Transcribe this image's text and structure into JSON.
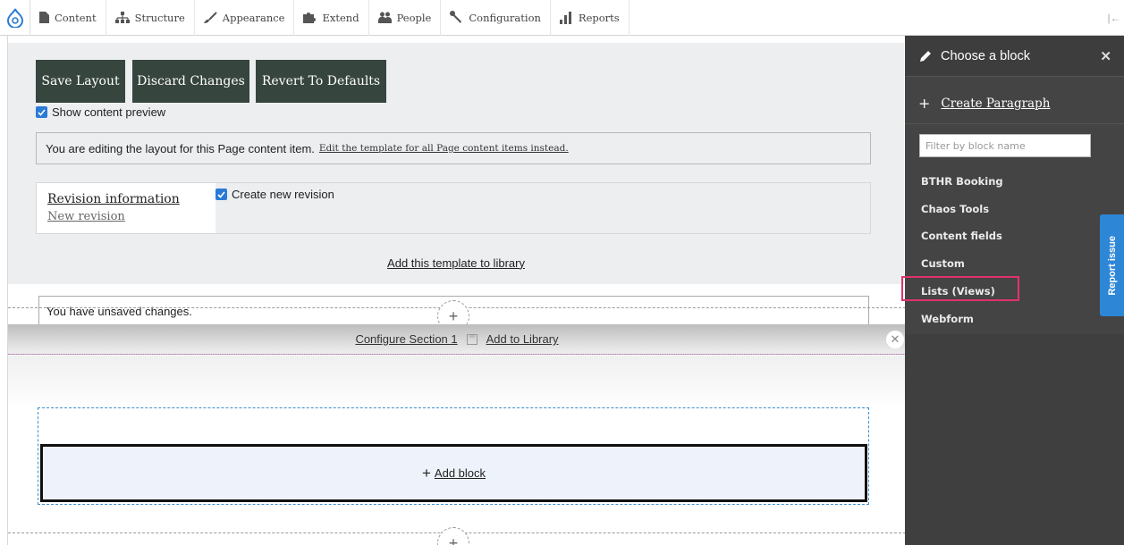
{
  "toolbar": {
    "items": [
      {
        "label": "Content",
        "icon": "file-icon"
      },
      {
        "label": "Structure",
        "icon": "sitemap-icon"
      },
      {
        "label": "Appearance",
        "icon": "paintbrush-icon"
      },
      {
        "label": "Extend",
        "icon": "puzzle-icon"
      },
      {
        "label": "People",
        "icon": "people-icon"
      },
      {
        "label": "Configuration",
        "icon": "wrench-icon"
      },
      {
        "label": "Reports",
        "icon": "bar-chart-icon"
      }
    ],
    "collapse_glyph": "|←"
  },
  "layout_builder": {
    "buttons": {
      "save": "Save Layout",
      "discard": "Discard Changes",
      "revert": "Revert To Defaults"
    },
    "show_preview_label": "Show content preview",
    "notice_text": "You are editing the layout for this Page content item.",
    "notice_link": "Edit the template for all Page content items instead.",
    "revision": {
      "title": "Revision information",
      "subtitle": "New revision",
      "create_label": "Create new revision"
    },
    "library_link": "Add this template to library",
    "unsaved_message": "You have unsaved changes.",
    "section": {
      "configure_label": "Configure Section 1",
      "library_label": "Add to Library",
      "close_glyph": "✕"
    },
    "add_block_label": "Add block",
    "plus_glyph": "+"
  },
  "offcanvas": {
    "title": "Choose a block",
    "close_glyph": "✕",
    "create_paragraph": "Create Paragraph",
    "filter_placeholder": "Filter by block name",
    "categories": [
      "BTHR Booking",
      "Chaos Tools",
      "Content fields",
      "Custom",
      "Lists (Views)",
      "Webform"
    ],
    "highlighted_category": "Lists (Views)"
  },
  "report_issue_label": "Report issue",
  "colors": {
    "accent_blue": "#2e86d6",
    "button_dark": "#36453e",
    "offcanvas_bg": "#444444",
    "highlight": "#e0336b"
  }
}
